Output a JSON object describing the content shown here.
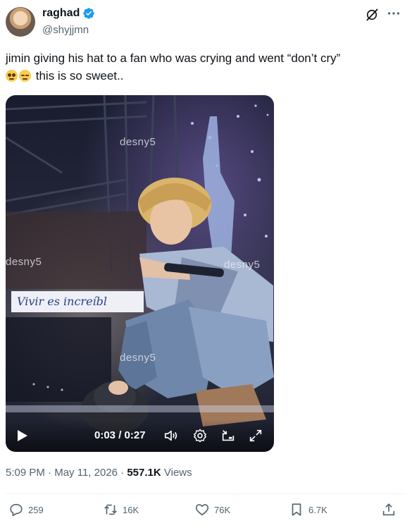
{
  "author": {
    "display_name": "raghad",
    "handle": "@shyjjmn"
  },
  "tweet": {
    "text_line1": "jimin giving his hat to a fan who was crying and went “don’t cry”",
    "text_line2": "this is so sweet..",
    "emojis": [
      "pleading-face-emoji",
      "pensive-face-emoji"
    ]
  },
  "video": {
    "watermark": "desny5",
    "banner_text": "Vivir es increíbl",
    "time_current": "0:03",
    "time_separator": " / ",
    "time_total": "0:27"
  },
  "meta": {
    "time": "5:09 PM",
    "sep1": " · ",
    "date": "May 11, 2026",
    "sep2": " · ",
    "views_count": "557.1K",
    "views_label": " Views"
  },
  "actions": {
    "replies": "259",
    "reposts": "16K",
    "likes": "76K",
    "bookmarks": "6.7K"
  },
  "colors": {
    "verified": "#1d9bf0",
    "secondary_text": "#536471",
    "primary_text": "#0f1419"
  }
}
